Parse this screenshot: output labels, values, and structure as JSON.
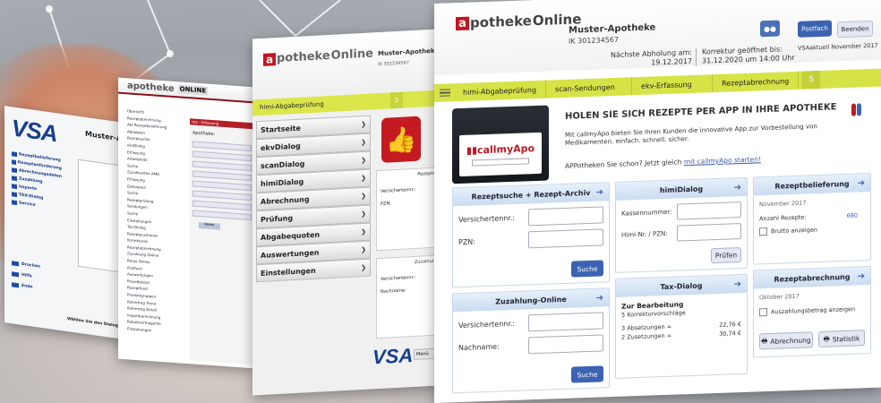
{
  "vsa_window": {
    "logo": "VSA",
    "title": "Muster-A",
    "menu": [
      "Rezeptbelieferung",
      "Rezeptanforderung",
      "Abrechnungsdaten",
      "Zuzahlung",
      "Importe",
      "TAX-Dialog",
      "Service"
    ],
    "bottom_menu": [
      "Drucken",
      "Hilfe",
      "Ende"
    ],
    "footer": "Wählen Sie den Dialog"
  },
  "old_window": {
    "logo": "apotheke",
    "logo_suffix": "ONLINE",
    "tree": [
      "Übersicht",
      "Rezeptabrechnung",
      "Akt Rezeptbelieferung",
      "Abholplan",
      "Rezeptsuche",
      "ekvDialog",
      "Erfassung",
      "Arbeitsliste",
      "Suche",
      "Zuzahlzeiten AMG",
      "Erfassung",
      "Datenpool",
      "Suche",
      "Rezeptprüfung",
      "Sendungen",
      "Suche",
      "Einstellungen",
      "Tax-Dialog",
      "Rezeptpositionen",
      "Korrekturen",
      "Rezeptabrechnung",
      "Zuzahlung Online",
      "Retax Online",
      "Postfach",
      "Auswertungen",
      "Prozeßdetail",
      "Rezeptfond",
      "Produktgruppen",
      "Rohertrag Trend",
      "Rohertrag Detail",
      "Importberechnung",
      "Rabattvertragsinfo",
      "Einstellungen"
    ],
    "panel_header": "rkd - Erfassung",
    "panel_label": "Apotheke:",
    "button": "Weiter"
  },
  "green_window": {
    "logo_a": "a",
    "logo_text": "potheke",
    "logo_text2": "Online",
    "pharmacy": "Muster-Apothek",
    "ik": "IK 301234567",
    "tab": "himi-Abgabeprüfung",
    "tab_number": "2",
    "nav": [
      "Startseite",
      "ekvDialog",
      "scanDialog",
      "himiDialog",
      "Abrechnung",
      "Prüfung",
      "Abgabequoten",
      "Auswertungen",
      "Einstellungen"
    ],
    "box1_header": "Rezepts",
    "box1_labels": [
      "Versichertennr.:",
      "PZN:"
    ],
    "box2_header": "Zuzahlun",
    "box2_labels": [
      "Versichertennr.:",
      "Nachname:"
    ],
    "vsa_logo": "VSA",
    "vsa_button": "Menü"
  },
  "main_window": {
    "logo_a": "a",
    "logo_text": "potheke",
    "logo_text2": "Online",
    "pharmacy": "Muster-Apotheke",
    "ik": "IK 301234567",
    "next_pickup_label": "Nächste Abholung am:",
    "next_pickup_date": "19.12.2017",
    "correction_label": "Korrektur geöffnet bis:",
    "correction_date": "31.12.2020 um 14:00 Uhr",
    "postfach": "Postfach",
    "beenden": "Beenden",
    "vsa_aktuell": "VSAaktuell November 2017",
    "tabs": [
      "himi-Abgabeprüfung",
      "scan-Sendungen",
      "ekv-Erfassung",
      "Rezeptabrechnung"
    ],
    "tab_number": "5",
    "promo_brand": "callmyApo",
    "promo_title": "HOLEN SIE SICH REZEPTE PER APP IN IHRE APOTHEKE",
    "promo_text": "Mit callmyApo bieten Sie Ihren Kunden die innovative App zur Vorbestellung von Medikamenten. einfach. schnell. sicher.",
    "promo_link_prefix": "APPotheken Sie schon? Jetzt gleich ",
    "promo_link": "mit callmyApo starten!",
    "card_search": {
      "title": "Rezeptsuche + Rezept-Archiv",
      "fields": [
        "Versichertennr.:",
        "PZN:"
      ],
      "button": "Suche"
    },
    "card_zuzahlung": {
      "title": "Zuzahlung-Online",
      "fields": [
        "Versichertennr.:",
        "Nachname:"
      ],
      "button": "Suche"
    },
    "card_himi": {
      "title": "himiDialog",
      "fields": [
        "Kassennummer:",
        "Himi-Nr. / PZN:"
      ],
      "button": "Prüfen"
    },
    "card_tax": {
      "title": "Tax-Dialog",
      "subtitle": "Zur Bearbeitung",
      "line1": "5 Korrekturvorschläge",
      "line2": "3 Absetzungen =",
      "value2": "22,76 €",
      "line3": "2 Zusetzungen =",
      "value3": "30,74 €"
    },
    "card_belieferung": {
      "title": "Rezeptbelieferung",
      "month": "November 2017",
      "count_label": "Anzahl Rezepte:",
      "count": "680",
      "checkbox": "Brutto anzeigen"
    },
    "card_abrechnung": {
      "title": "Rezeptabrechnung",
      "month": "Oktober 2017",
      "checkbox": "Auszahlungsbetrag anzeigen",
      "btn1": "Abrechnung",
      "btn2": "Statistik"
    }
  }
}
